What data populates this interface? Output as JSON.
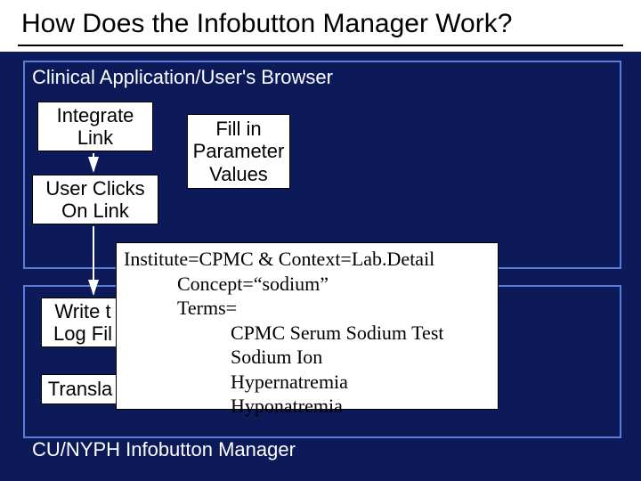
{
  "title": "How Does the Infobutton Manager Work?",
  "sections": {
    "top_label": "Clinical Application/User's Browser",
    "bottom_label": "CU/NYPH Infobutton Manager"
  },
  "process": {
    "integrate": "Integrate Link",
    "user_clicks": "User Clicks On Link",
    "fill_in": "Fill in Parameter Values",
    "write_log": "Write t Log Fil",
    "translate": "Transla"
  },
  "detail": {
    "line1": "Institute=CPMC & Context=Lab.Detail",
    "line2": "Concept=“sodium”",
    "line3": "Terms=",
    "term1": "CPMC Serum Sodium Test",
    "term2": "Sodium Ion",
    "term3": "Hypernatremia",
    "term4": "Hyponatremia"
  }
}
